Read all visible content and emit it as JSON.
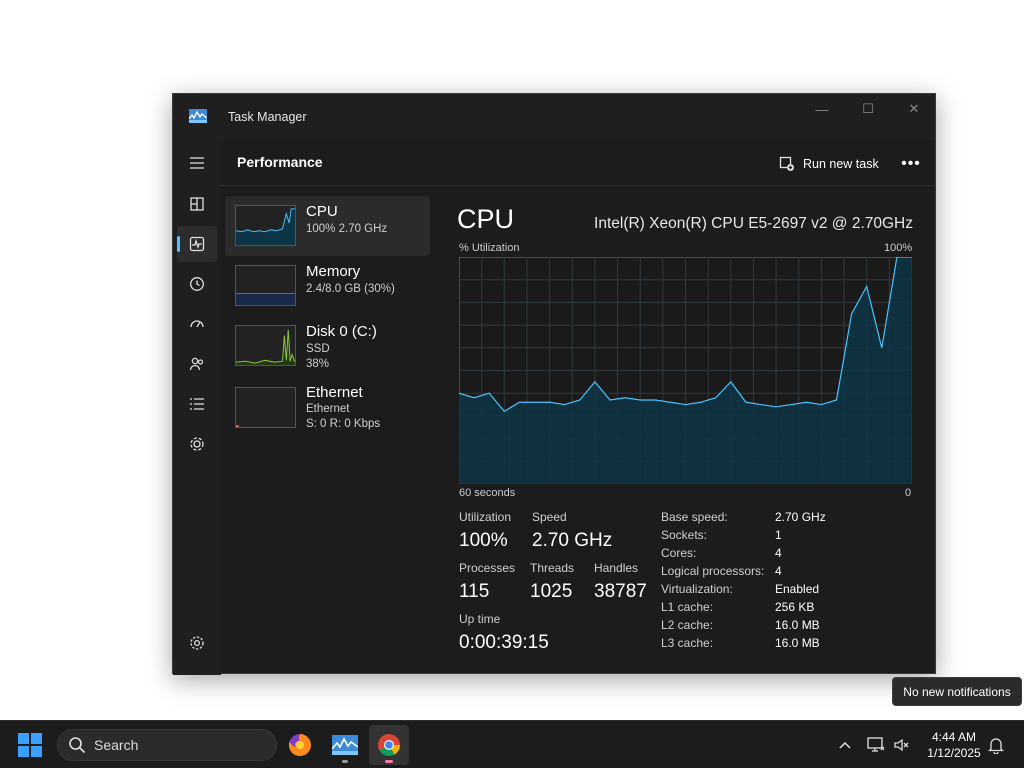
{
  "window": {
    "title": "Task Manager",
    "controls": {
      "minimize": "—",
      "maximize": "☐",
      "close": "✕"
    }
  },
  "header": {
    "title": "Performance",
    "run_new_task": "Run new task",
    "more": "•••"
  },
  "nav_rail": {
    "items": [
      {
        "icon": "hamburger-menu-icon"
      },
      {
        "icon": "processes-icon"
      },
      {
        "icon": "performance-icon",
        "active": true
      },
      {
        "icon": "app-history-icon"
      },
      {
        "icon": "startup-apps-icon"
      },
      {
        "icon": "users-icon"
      },
      {
        "icon": "details-icon"
      },
      {
        "icon": "services-icon"
      },
      {
        "icon": "settings-icon"
      }
    ]
  },
  "resources": [
    {
      "name": "CPU",
      "line1": "100%  2.70 GHz",
      "line2": "",
      "selected": true,
      "color": "#4cc2ff"
    },
    {
      "name": "Memory",
      "line1": "2.4/8.0 GB (30%)",
      "line2": "",
      "color": "#4c7dd8"
    },
    {
      "name": "Disk 0 (C:)",
      "line1": "SSD",
      "line2": "38%",
      "color": "#8cc63e"
    },
    {
      "name": "Ethernet",
      "line1": "Ethernet",
      "line2": "S: 0  R: 0 Kbps",
      "color": "#d26a4f"
    }
  ],
  "detail": {
    "title": "CPU",
    "model": "Intel(R) Xeon(R) CPU E5-2697 v2 @ 2.70GHz",
    "graph_top_left": "% Utilization",
    "graph_top_right": "100%",
    "graph_bottom_left": "60 seconds",
    "graph_bottom_right": "0",
    "stats": {
      "utilization_label": "Utilization",
      "utilization": "100%",
      "speed_label": "Speed",
      "speed": "2.70 GHz",
      "processes_label": "Processes",
      "processes": "115",
      "threads_label": "Threads",
      "threads": "1025",
      "handles_label": "Handles",
      "handles": "38787",
      "uptime_label": "Up time",
      "uptime": "0:00:39:15"
    },
    "specs": [
      {
        "key": "Base speed:",
        "value": "2.70 GHz"
      },
      {
        "key": "Sockets:",
        "value": "1"
      },
      {
        "key": "Cores:",
        "value": "4"
      },
      {
        "key": "Logical processors:",
        "value": "4"
      },
      {
        "key": "Virtualization:",
        "value": "Enabled"
      },
      {
        "key": "L1 cache:",
        "value": "256 KB"
      },
      {
        "key": "L2 cache:",
        "value": "16.0 MB"
      },
      {
        "key": "L3 cache:",
        "value": "16.0 MB"
      }
    ]
  },
  "chart_data": {
    "type": "area",
    "x": [
      0,
      2,
      4,
      6,
      8,
      10,
      12,
      14,
      16,
      18,
      20,
      22,
      24,
      26,
      28,
      30,
      32,
      34,
      36,
      38,
      40,
      42,
      44,
      46,
      48,
      50,
      52,
      54,
      56,
      58,
      60
    ],
    "xlim": [
      0,
      60
    ],
    "ylim": [
      0,
      100
    ],
    "y": [
      40,
      38,
      40,
      32,
      36,
      36,
      36,
      35,
      37,
      45,
      37,
      38,
      37,
      37,
      36,
      35,
      36,
      38,
      45,
      36,
      35,
      34,
      35,
      36,
      35,
      37,
      75,
      87,
      60,
      100,
      100
    ],
    "grid": true,
    "line_color": "#4cc2ff",
    "fill_color": "#0e3545"
  },
  "notification": {
    "text": "No new notifications"
  },
  "taskbar": {
    "search_placeholder": "Search",
    "apps": [
      {
        "icon": "firefox-icon"
      },
      {
        "icon": "task-manager-icon"
      },
      {
        "icon": "chrome-icon",
        "active": true
      }
    ],
    "tray": [
      "chevron-up-icon",
      "network-icon",
      "volume-muted-icon"
    ],
    "time": "4:44 AM",
    "date": "1/12/2025"
  }
}
